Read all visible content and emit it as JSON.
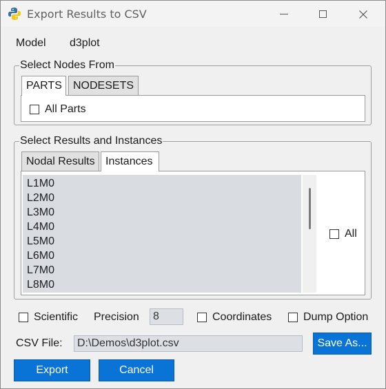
{
  "window": {
    "title": "Export Results to CSV",
    "controls": [
      "minimize",
      "maximize",
      "close"
    ]
  },
  "model": {
    "label": "Model",
    "value": "d3plot"
  },
  "nodes_group": {
    "title": "Select Nodes From",
    "tabs": [
      {
        "label": "PARTS",
        "active": true
      },
      {
        "label": "NODESETS",
        "active": false
      }
    ],
    "all_parts_label": "All Parts",
    "all_parts_checked": false
  },
  "results_group": {
    "title": "Select Results and Instances",
    "tabs": [
      {
        "label": "Nodal Results",
        "active": false
      },
      {
        "label": "Instances",
        "active": true
      }
    ],
    "instances": [
      "L1M0",
      "L2M0",
      "L3M0",
      "L4M0",
      "L5M0",
      "L6M0",
      "L7M0",
      "L8M0"
    ],
    "all_label": "All",
    "all_checked": false
  },
  "options": {
    "scientific_label": "Scientific",
    "scientific_checked": false,
    "precision_label": "Precision",
    "precision_value": "8",
    "coordinates_label": "Coordinates",
    "coordinates_checked": false,
    "dump_label": "Dump Option",
    "dump_checked": false
  },
  "csv": {
    "label": "CSV File:",
    "path": "D:\\Demos\\d3plot.csv",
    "save_as_label": "Save As..."
  },
  "buttons": {
    "export": "Export",
    "cancel": "Cancel"
  },
  "colors": {
    "accent": "#0a74d6",
    "list_bg": "#d9dce1",
    "window_bg": "#f0f0f0"
  }
}
